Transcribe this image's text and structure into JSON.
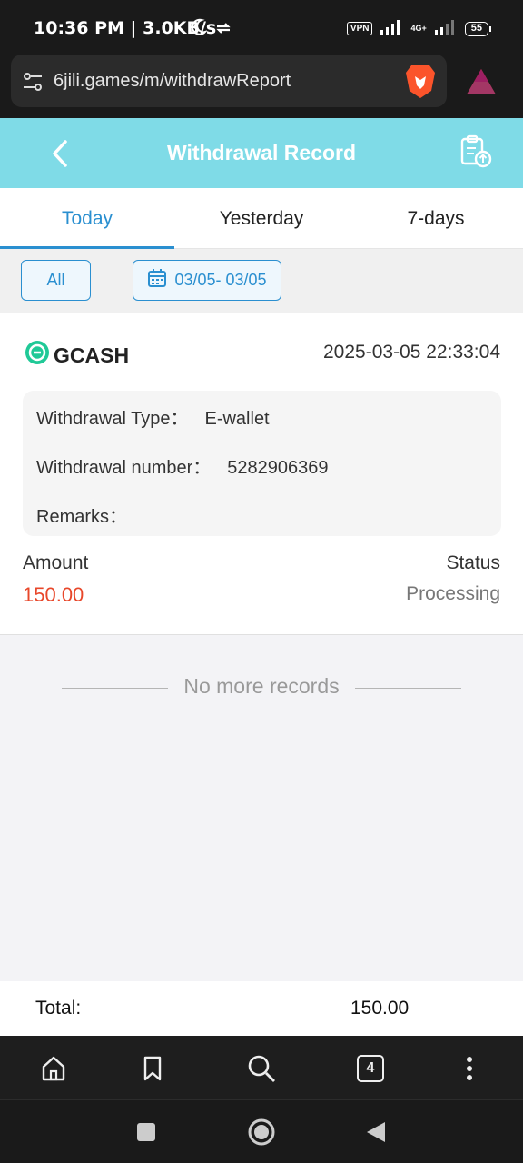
{
  "status_bar": {
    "time": "10:36 PM | 3.0KB/s",
    "vpn": "VPN",
    "network": "4G+",
    "battery": "55"
  },
  "browser": {
    "url": "6jili.games/m/withdrawReport",
    "tab_count": "4"
  },
  "header": {
    "title": "Withdrawal Record"
  },
  "tabs": [
    {
      "label": "Today",
      "active": true
    },
    {
      "label": "Yesterday",
      "active": false
    },
    {
      "label": "7-days",
      "active": false
    }
  ],
  "filters": {
    "all_label": "All",
    "date_range": "03/05- 03/05"
  },
  "record": {
    "method": "GCASH",
    "datetime": "2025-03-05 22:33:04",
    "type_label": "Withdrawal Type：",
    "type_value": "E-wallet",
    "number_label": "Withdrawal number：",
    "number_value": "5282906369",
    "remarks_label": "Remarks：",
    "amount_label": "Amount",
    "amount_value": "150.00",
    "status_label": "Status",
    "status_value": "Processing"
  },
  "no_more": "No more records",
  "total": {
    "label": "Total:",
    "value": "150.00"
  },
  "colors": {
    "header_bg": "#7fdbe7",
    "accent": "#2a8fd0",
    "amount": "#e8472a"
  }
}
